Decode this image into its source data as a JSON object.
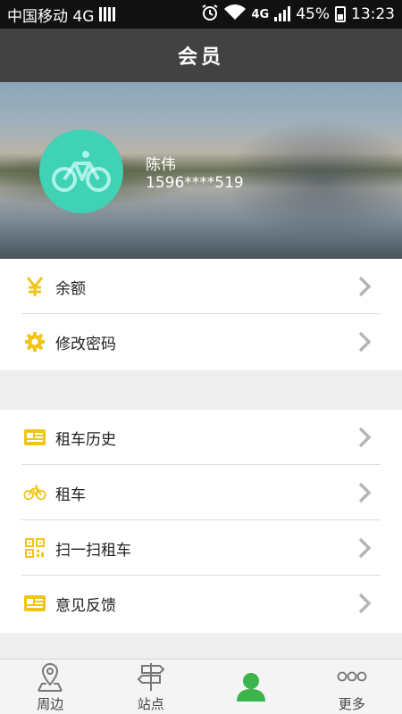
{
  "status_bar": {
    "carrier": "中国移动 4G",
    "network": "4G",
    "battery": "45%",
    "time": "13:23"
  },
  "title": "会员",
  "user": {
    "name": "陈伟",
    "phone": "1596****519"
  },
  "menu_group_1": [
    {
      "label": "余额",
      "icon": "yen-icon"
    },
    {
      "label": "修改密码",
      "icon": "gear-icon"
    }
  ],
  "menu_group_2": [
    {
      "label": "租车历史",
      "icon": "card-icon"
    },
    {
      "label": "租车",
      "icon": "bicycle-icon"
    },
    {
      "label": "扫一扫租车",
      "icon": "qr-code-icon"
    },
    {
      "label": "意见反馈",
      "icon": "card-icon"
    }
  ],
  "bottom_nav": [
    {
      "label": "周边",
      "icon": "location-pin-icon"
    },
    {
      "label": "站点",
      "icon": "signpost-icon"
    },
    {
      "label": "",
      "icon": "person-icon"
    },
    {
      "label": "更多",
      "icon": "more-dots-icon"
    }
  ],
  "colors": {
    "accent_yellow": "#f0c419",
    "avatar_teal": "#3fd2b5",
    "active_green": "#3bb54a",
    "title_bar": "#424242"
  }
}
